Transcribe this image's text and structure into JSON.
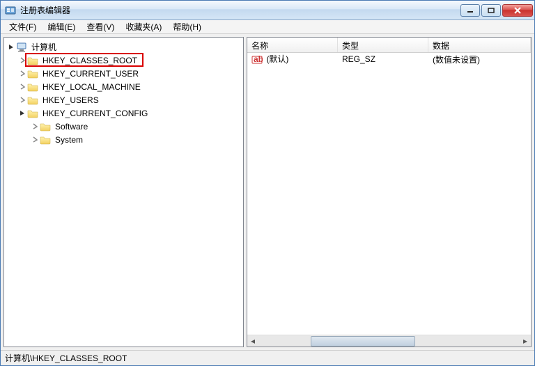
{
  "window": {
    "title": "注册表编辑器"
  },
  "menu": {
    "file": "文件(F)",
    "edit": "编辑(E)",
    "view": "查看(V)",
    "fav": "收藏夹(A)",
    "help": "帮助(H)"
  },
  "tree": {
    "root": "计算机",
    "k0": "HKEY_CLASSES_ROOT",
    "k1": "HKEY_CURRENT_USER",
    "k2": "HKEY_LOCAL_MACHINE",
    "k3": "HKEY_USERS",
    "k4": "HKEY_CURRENT_CONFIG",
    "k4a": "Software",
    "k4b": "System"
  },
  "columns": {
    "name": "名称",
    "type": "类型",
    "data": "数据"
  },
  "row0": {
    "name": "(默认)",
    "type": "REG_SZ",
    "data": "(数值未设置)"
  },
  "status": "计算机\\HKEY_CLASSES_ROOT"
}
